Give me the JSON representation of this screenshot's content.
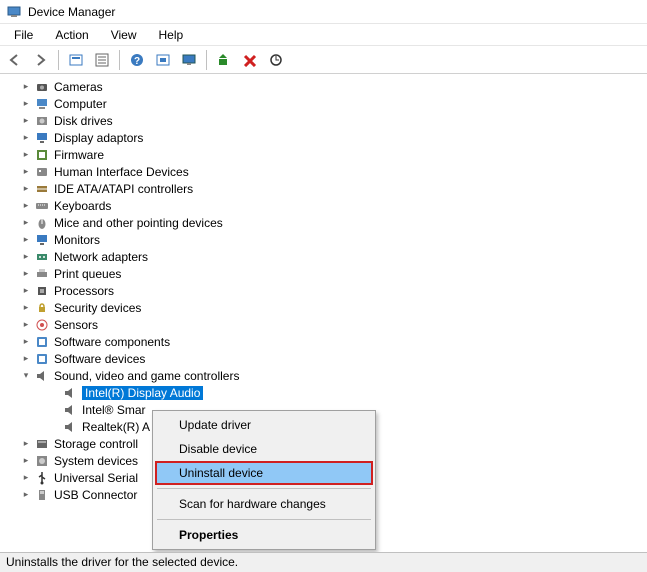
{
  "window": {
    "title": "Device Manager"
  },
  "menu": {
    "file": "File",
    "action": "Action",
    "view": "View",
    "help": "Help"
  },
  "toolbar_icons": {
    "back": "back-arrow",
    "forward": "forward-arrow",
    "show_hidden": "show-hidden",
    "properties": "properties",
    "help": "help",
    "print": "print",
    "monitor_refresh": "monitor",
    "update": "update-driver",
    "delete": "delete",
    "scan": "scan-hardware"
  },
  "tree": [
    {
      "label": "Cameras",
      "icon": "camera"
    },
    {
      "label": "Computer",
      "icon": "computer"
    },
    {
      "label": "Disk drives",
      "icon": "disk"
    },
    {
      "label": "Display adaptors",
      "icon": "display"
    },
    {
      "label": "Firmware",
      "icon": "firmware"
    },
    {
      "label": "Human Interface Devices",
      "icon": "hid"
    },
    {
      "label": "IDE ATA/ATAPI controllers",
      "icon": "ide"
    },
    {
      "label": "Keyboards",
      "icon": "keyboard"
    },
    {
      "label": "Mice and other pointing devices",
      "icon": "mouse"
    },
    {
      "label": "Monitors",
      "icon": "monitor"
    },
    {
      "label": "Network adapters",
      "icon": "network"
    },
    {
      "label": "Print queues",
      "icon": "printer"
    },
    {
      "label": "Processors",
      "icon": "cpu"
    },
    {
      "label": "Security devices",
      "icon": "security"
    },
    {
      "label": "Sensors",
      "icon": "sensor"
    },
    {
      "label": "Software components",
      "icon": "software"
    },
    {
      "label": "Software devices",
      "icon": "software"
    }
  ],
  "expanded_node": {
    "label": "Sound, video and game controllers",
    "icon": "sound",
    "children": [
      {
        "label": "Intel(R) Display Audio",
        "selected": true
      },
      {
        "label": "Intel® Smar"
      },
      {
        "label": "Realtek(R) A"
      }
    ]
  },
  "tree_after": [
    {
      "label": "Storage controll",
      "icon": "storage"
    },
    {
      "label": "System devices",
      "icon": "system"
    },
    {
      "label": "Universal Serial",
      "icon": "usb"
    },
    {
      "label": "USB Connector",
      "icon": "usb-connector"
    }
  ],
  "context_menu": {
    "update": "Update driver",
    "disable": "Disable device",
    "uninstall": "Uninstall device",
    "scan": "Scan for hardware changes",
    "properties": "Properties"
  },
  "statusbar": {
    "text": "Uninstalls the driver for the selected device."
  }
}
